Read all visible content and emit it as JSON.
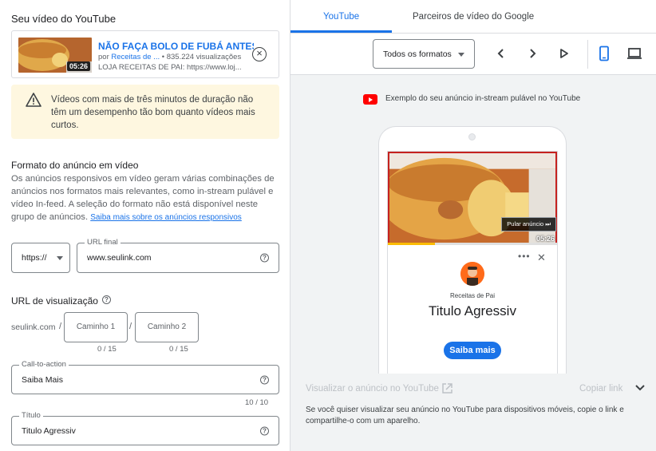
{
  "left": {
    "section_title": "Seu vídeo do YouTube",
    "video": {
      "title": "NÃO FAÇA BOLO DE FUBÁ ANTES...",
      "by": "por",
      "channel": "Receitas de ...",
      "views": "• 835.224 visualizações",
      "description": "LOJA RECEITAS DE PAI: https://www.loj...",
      "duration": "05:26"
    },
    "warning": "Vídeos com mais de três minutos de duração não têm um desempenho tão bom quanto vídeos mais curtos.",
    "format": {
      "heading": "Formato do anúncio em vídeo",
      "body": "Os anúncios responsivos em vídeo geram várias combinações de anúncios nos formatos mais relevantes, como in-stream pulável e vídeo In-feed. A seleção do formato não está disponível neste grupo de anúncios.",
      "link": "Saiba mais sobre os anúncios responsivos"
    },
    "protocol": "https://",
    "final_url": {
      "label": "URL final",
      "value": "www.seulink.com"
    },
    "display_url": {
      "heading": "URL de visualização",
      "domain": "seulink.com",
      "path1": "Caminho 1",
      "path2": "Caminho 2",
      "counter1": "0 / 15",
      "counter2": "0 / 15"
    },
    "cta": {
      "label": "Call-to-action",
      "value": "Saiba Mais",
      "counter": "10 / 10"
    },
    "titulo": {
      "label": "Título",
      "value": "Titulo Agressiv"
    }
  },
  "right": {
    "tabs": [
      "YouTube",
      "Parceiros de vídeo do Google"
    ],
    "format_select": "Todos os formatos",
    "example_caption": "Exemplo do seu anúncio in-stream pulável no YouTube",
    "preview": {
      "skip": "Pular anúncio ⏭",
      "duration": "05:26",
      "channel": "Receitas de Pai",
      "headline": "Titulo Agressiv",
      "cta": "Saiba mais",
      "progress": 0.28
    },
    "view_on_youtube": "Visualizar o anúncio no YouTube",
    "copy_link": "Copiar link",
    "info": "Se você quiser visualizar seu anúncio no YouTube para dispositivos móveis, copie o link e compartilhe-o com um aparelho."
  },
  "colors": {
    "accent": "#1a73e8",
    "warning_bg": "#fef7e0",
    "youtube_red": "#ff0000"
  }
}
